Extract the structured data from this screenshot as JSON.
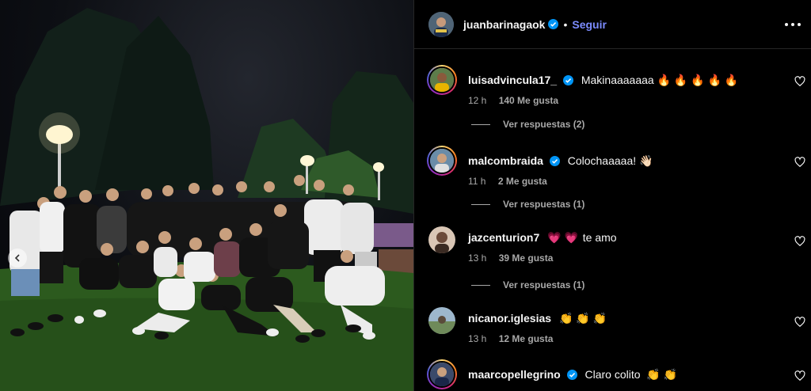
{
  "post": {
    "author": "juanbarinagaok",
    "follow_label": "Seguir",
    "separator": "•"
  },
  "comments": [
    {
      "user": "luisadvincula17_",
      "text": "Makinaaaaaaa",
      "emoji": "🔥 🔥 🔥 🔥 🔥",
      "time": "12 h",
      "likes": "140 Me gusta",
      "replies": "Ver respuestas (2)",
      "verified": true
    },
    {
      "user": "malcombraida",
      "text": "Colochaaaaa!",
      "emoji": "👋🏻",
      "time": "11 h",
      "likes": "2 Me gusta",
      "replies": "Ver respuestas (1)",
      "verified": true
    },
    {
      "user": "jazcenturion7",
      "text": "te amo",
      "emoji_pre": "💗 💗",
      "time": "13 h",
      "likes": "39 Me gusta",
      "replies": "Ver respuestas (1)",
      "verified": false
    },
    {
      "user": "nicanor.iglesias",
      "text": "",
      "emoji": "👏 👏 👏",
      "time": "13 h",
      "likes": "12 Me gusta",
      "verified": false
    },
    {
      "user": "maarcopellegrino",
      "text": "Claro colito",
      "emoji": "👏 👏",
      "verified": true
    }
  ],
  "colors": {
    "accent": "#7c8cff",
    "verified": "#0095f6",
    "muted": "#a8a8a8"
  }
}
